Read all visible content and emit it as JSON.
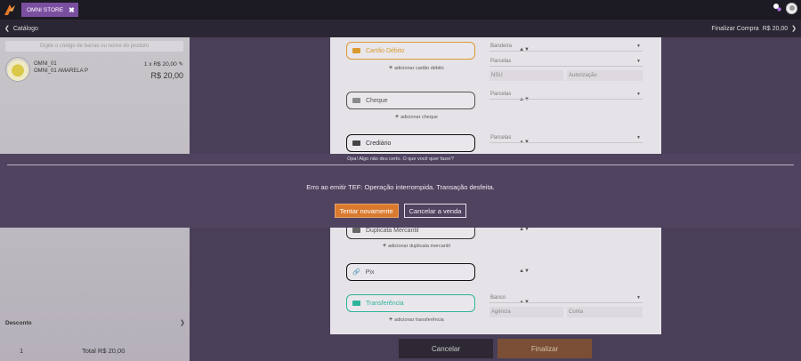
{
  "app": {
    "store_tab": "OMNI STORE",
    "close_glyph": "✖"
  },
  "subbar": {
    "back_label": "Catálogo",
    "finalize_label": "Finalizar Compra",
    "finalize_total": "R$ 20,00"
  },
  "left": {
    "search_placeholder": "Digite o código de barras ou nome do produto",
    "item": {
      "code": "OMNI_01",
      "name": "OMNI_01 AMARELA P",
      "qty": "1 x R$ 20,00",
      "price": "R$ 20,00"
    },
    "desconto_label": "Desconto",
    "footer_count": "1",
    "footer_total": "Total R$ 20,00"
  },
  "payments": {
    "debit": {
      "label": "Cartão Débito",
      "add": "adicionar cartão débito"
    },
    "cheque": {
      "label": "Cheque",
      "add": "adicionar cheque"
    },
    "crediario": {
      "label": "Crediário"
    },
    "duplicata": {
      "label": "Duplicata Mercantil",
      "add": "adicionar duplicata mercantil"
    },
    "pix": {
      "label": "Pix"
    },
    "transfer": {
      "label": "Transferência",
      "add": "adicionar transferência"
    },
    "bandeira": "Bandeira",
    "parcelas": "Parcelas",
    "nsu": "NSU",
    "autorizacao": "Autorização",
    "banco": "Banco",
    "agencia": "Agência",
    "conta": "Conta"
  },
  "bottom": {
    "cancel": "Cancelar",
    "finalize": "Finalizar"
  },
  "modal": {
    "header": "Opa! Algo não deu certo. O que você quer fazer?",
    "message": "Erro ao emitir TEF: Operação interrompida. Transação desfeita.",
    "retry": "Tentar novamente",
    "cancel_sale": "Cancelar a venda"
  },
  "colors": {
    "accent_orange": "#d97a2e",
    "tab_purple": "#7b4fa0",
    "debit_border": "#d99a2e",
    "transfer_border": "#2fb39a"
  }
}
